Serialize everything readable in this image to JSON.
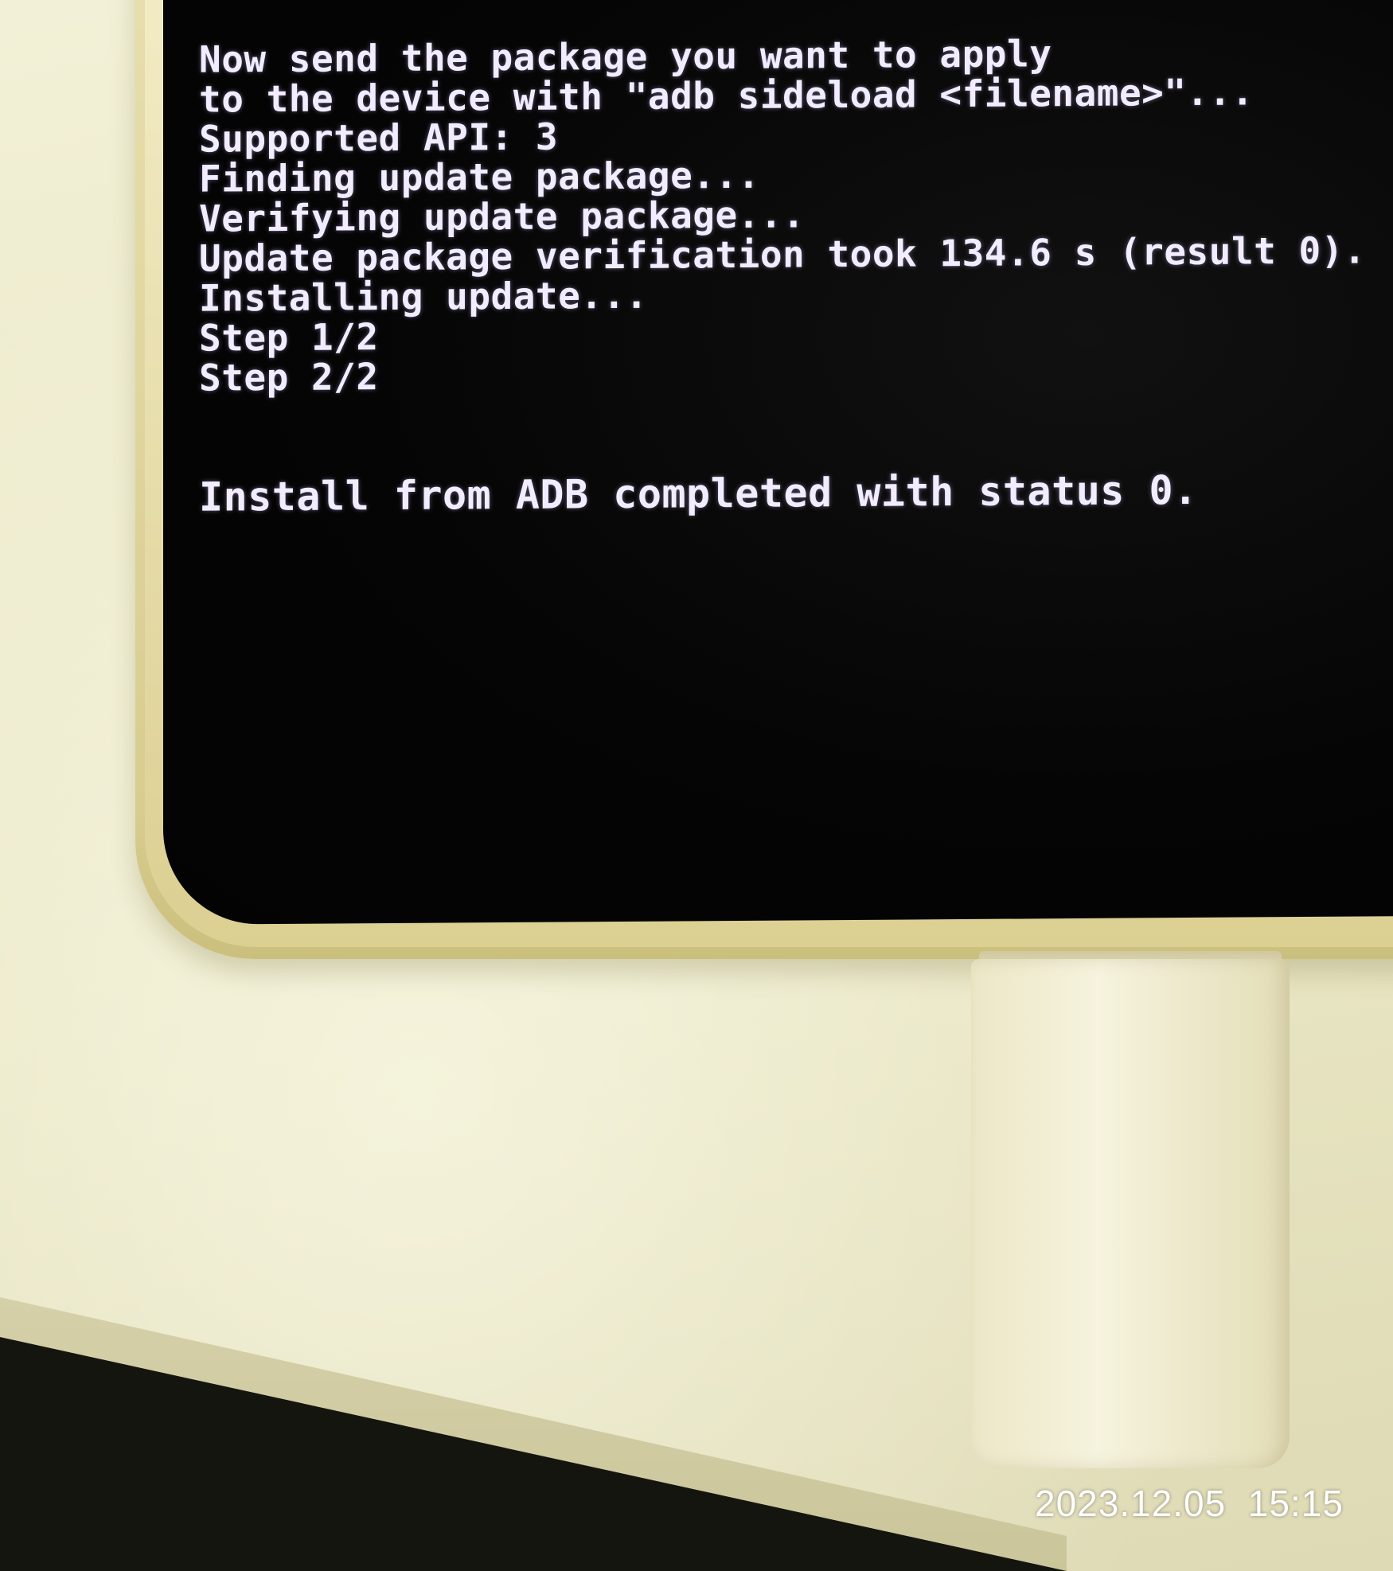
{
  "terminal": {
    "lines": [
      "Now send the package you want to apply",
      "to the device with \"adb sideload <filename>\"...",
      "Supported API: 3",
      "Finding update package...",
      "Verifying update package...",
      "Update package verification took 134.6 s (result 0).",
      "Installing update...",
      "Step 1/2",
      "Step 2/2",
      "Install from ADB completed with status 0."
    ]
  },
  "photo": {
    "timestamp": "2023.12.05  15:15"
  },
  "colors": {
    "screen_bg": "#050505",
    "terminal_text": "#f2ecff",
    "phone_frame": "#d8cd8f",
    "surface": "#ece9c8"
  }
}
